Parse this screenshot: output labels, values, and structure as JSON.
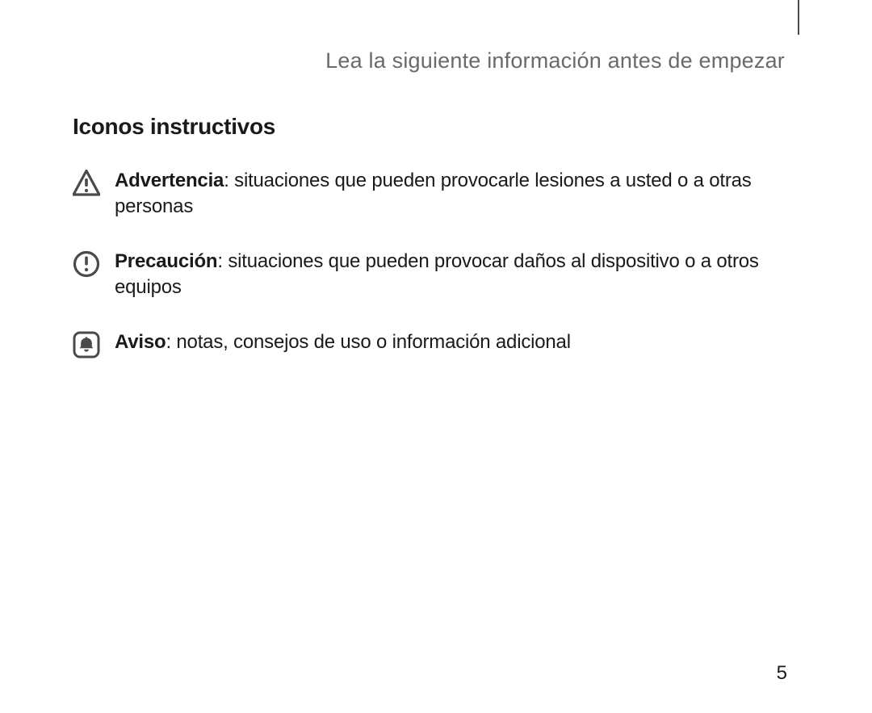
{
  "header": "Lea la siguiente información antes de empezar",
  "section_heading": "Iconos instructivos",
  "items": [
    {
      "label": "Advertencia",
      "desc": ": situaciones que pueden provocarle lesiones a usted o a otras personas"
    },
    {
      "label": "Precaución",
      "desc": ": situaciones que pueden provocar daños al dispositivo o a otros equipos"
    },
    {
      "label": "Aviso",
      "desc": ": notas, consejos de uso o información adicional"
    }
  ],
  "page_number": "5"
}
